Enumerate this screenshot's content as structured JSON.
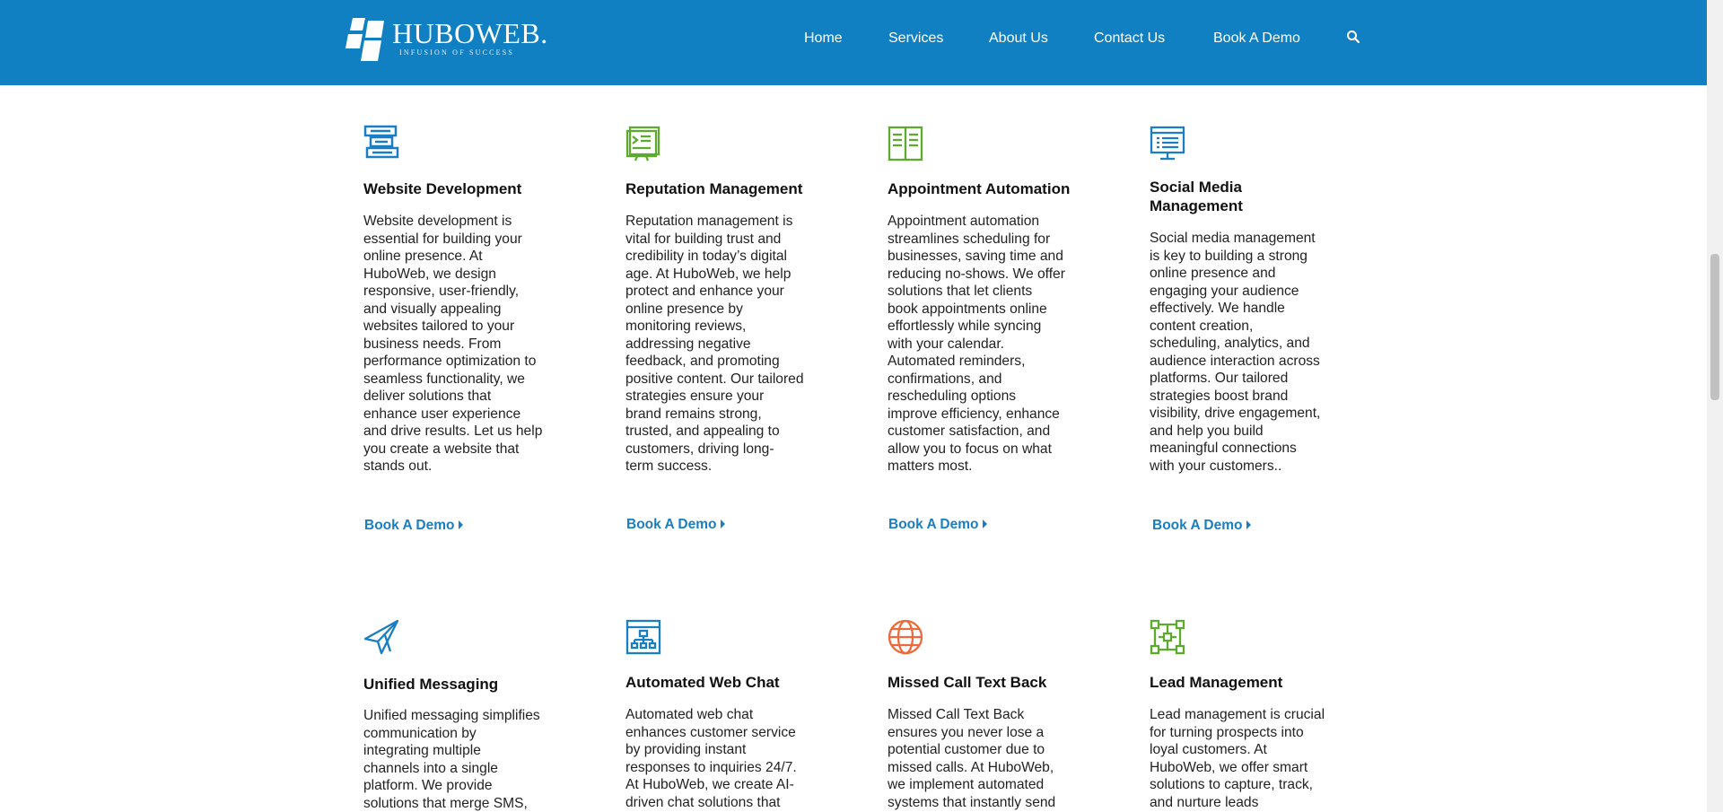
{
  "header": {
    "logo": {
      "name": "HUBOWEB.",
      "tagline": "INFUSION OF SUCCESS"
    },
    "nav": [
      {
        "label": "Home"
      },
      {
        "label": "Services"
      },
      {
        "label": "About Us"
      },
      {
        "label": "Contact Us"
      },
      {
        "label": "Book A Demo"
      }
    ],
    "search_icon": "search-icon"
  },
  "colors": {
    "header_bg": "#1180c3",
    "link": "#1a7ec2",
    "icon_blue": "#1a7ec2",
    "icon_green": "#5daa2f",
    "icon_orange": "#ec6a3c"
  },
  "services": [
    {
      "icon": "website-development-icon",
      "title": "Website Development",
      "lines": [
        "Website development is",
        "essential for building your",
        "online presence. At",
        "HuboWeb, we design",
        "responsive, user-friendly,",
        "and visually appealing",
        "websites tailored to your",
        "business needs. From",
        "performance optimization to",
        "seamless functionality, we",
        "deliver solutions that",
        "enhance user experience",
        "and drive results. Let us help",
        "you create a website that",
        "stands out."
      ],
      "cta": "Book A Demo"
    },
    {
      "icon": "reputation-management-icon",
      "title": "Reputation Management",
      "lines": [
        "Reputation management is",
        "vital for building trust and",
        "credibility in today’s digital",
        "age. At HuboWeb, we help",
        "protect and enhance your",
        "online presence by",
        "monitoring reviews,",
        "addressing negative",
        "feedback, and promoting",
        "positive content. Our tailored",
        "strategies ensure your",
        "brand remains strong,",
        "trusted, and appealing to",
        "customers, driving long-",
        "term success."
      ],
      "cta": "Book A Demo"
    },
    {
      "icon": "appointment-automation-icon",
      "title": "Appointment Automation",
      "lines": [
        "Appointment automation",
        "streamlines scheduling for",
        "businesses, saving time and",
        "reducing no-shows. We offer",
        "solutions that let clients",
        "book appointments online",
        "effortlessly while syncing",
        "with your calendar.",
        "Automated reminders,",
        "confirmations, and",
        "rescheduling options",
        "improve efficiency, enhance",
        "customer satisfaction, and",
        "allow you to focus on what",
        "matters most."
      ],
      "cta": "Book A Demo"
    },
    {
      "icon": "social-media-management-icon",
      "title_lines": [
        "Social Media",
        "Management"
      ],
      "lines": [
        "Social media management",
        "is key to building a strong",
        "online presence and",
        "engaging your audience",
        "effectively. We handle",
        "content creation,",
        "scheduling, analytics, and",
        "audience interaction across",
        "platforms. Our tailored",
        "strategies boost brand",
        "visibility, drive engagement,",
        "and help you build",
        "meaningful connections",
        "with your customers.."
      ],
      "cta": "Book A Demo"
    },
    {
      "icon": "paper-plane-icon",
      "title": "Unified Messaging",
      "lines": [
        "Unified messaging simplifies",
        "communication by",
        "integrating multiple",
        "channels into a single",
        "platform. We provide",
        "solutions that merge SMS,"
      ]
    },
    {
      "icon": "sitemap-icon",
      "title": "Automated Web Chat",
      "lines": [
        "Automated web chat",
        "enhances customer service",
        "by providing instant",
        "responses to inquiries 24/7.",
        "At HuboWeb, we create AI-",
        "driven chat solutions that"
      ]
    },
    {
      "icon": "globe-icon",
      "title": "Missed Call Text Back",
      "lines": [
        "Missed Call Text Back",
        "ensures you never lose a",
        "potential customer due to",
        "missed calls. At HuboWeb,",
        "we implement automated",
        "systems that instantly send"
      ]
    },
    {
      "icon": "network-nodes-icon",
      "title": "Lead Management",
      "lines": [
        "Lead management is crucial",
        "for turning prospects into",
        "loyal customers. At",
        "HuboWeb, we offer smart",
        "solutions to capture, track,",
        "and nurture leads"
      ]
    }
  ]
}
